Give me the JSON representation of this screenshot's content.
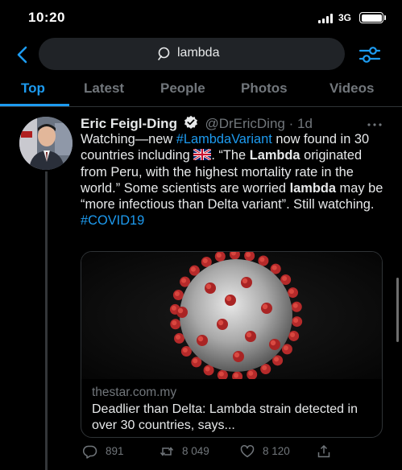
{
  "status_bar": {
    "time": "10:20",
    "network": "3G"
  },
  "search": {
    "query": "lambda"
  },
  "tabs": [
    {
      "label": "Top",
      "active": true
    },
    {
      "label": "Latest",
      "active": false
    },
    {
      "label": "People",
      "active": false
    },
    {
      "label": "Photos",
      "active": false
    },
    {
      "label": "Videos",
      "active": false
    }
  ],
  "tweet": {
    "author_name": "Eric Feigl-Ding",
    "handle": "@DrEricDing",
    "separator": "·",
    "time": "1d",
    "text": {
      "p1": "Watching—new ",
      "hashtag1": "#LambdaVariant",
      "p2": " now found in 30 countries including ",
      "p3": ". “The ",
      "bold1": "Lambda",
      "p4": " originated from Peru, with the highest mortality rate in the world.” Some scientists are worried ",
      "bold2": "lambda",
      "p5": " may be “more infectious than Delta variant”. Still watching. ",
      "hashtag2": "#COVID19"
    },
    "card": {
      "domain": "thestar.com.my",
      "title": "Deadlier than Delta: Lambda strain detected in over 30 countries, says..."
    },
    "actions": {
      "replies": "891",
      "retweets": "8 049",
      "likes": "8 120"
    }
  },
  "colors": {
    "accent": "#1d9bf0",
    "background": "#000000",
    "secondary_text": "#71767b"
  },
  "icons": [
    "back-arrow-icon",
    "search-icon",
    "filter-sliders-icon",
    "verified-badge-icon",
    "more-dots-icon",
    "uk-flag-icon",
    "reply-icon",
    "retweet-icon",
    "like-icon",
    "share-icon"
  ]
}
